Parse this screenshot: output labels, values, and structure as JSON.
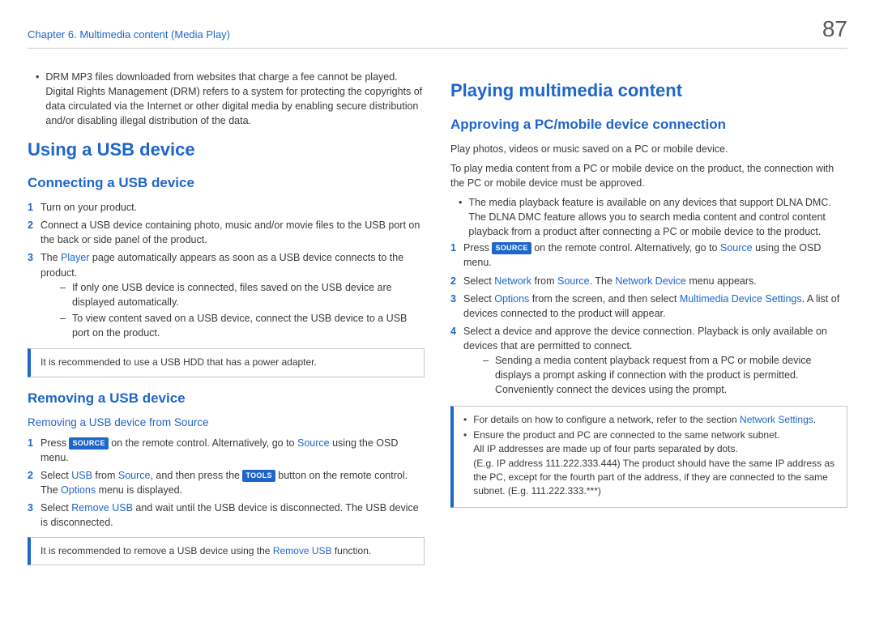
{
  "page_number": "87",
  "header": "Chapter 6. Multimedia content (Media Play)",
  "left": {
    "intro_bullet_pre": "DRM MP3 files downloaded from websites that charge a fee cannot be played.",
    "intro_bullet_post": "Digital Rights Management (DRM) refers to a system for protecting the copyrights of data circulated via the Internet or other digital media by enabling secure distribution and/or disabling illegal distribution of the data.",
    "h1_usb": "Using a USB device",
    "h2_connect": "Connecting a USB device",
    "c1": "Turn on your product.",
    "c2": "Connect a USB device containing photo, music and/or movie files to the USB port on the back or side panel of the product.",
    "c3_pre": "The ",
    "c3_player": "Player",
    "c3_post": " page automatically appears as soon as a USB device connects to the product.",
    "c3_d1": "If only one USB device is connected, files saved on the USB device are displayed automatically.",
    "c3_d2": "To view content saved on a USB device, connect the USB device to a USB port on the product.",
    "note1": "It is recommended to use a USB HDD that has a power adapter.",
    "h2_remove": "Removing a USB device",
    "h3_remove": "Removing a USB device from Source",
    "r1_pre": "Press ",
    "r1_key": "SOURCE",
    "r1_mid": " on the remote control. Alternatively, go to ",
    "r1_source": "Source",
    "r1_post": " using the OSD menu.",
    "r2_pre": "Select ",
    "r2_usb": "USB",
    "r2_mid1": " from ",
    "r2_src": "Source",
    "r2_mid2": ", and then press the ",
    "r2_key": "TOOLS",
    "r2_mid3": " button on the remote control. The ",
    "r2_opt": "Options",
    "r2_post": " menu is displayed.",
    "r3_pre": "Select ",
    "r3_rem": "Remove USB",
    "r3_post": " and wait until the USB device is disconnected. The USB device is disconnected.",
    "note2_pre": "It is recommended to remove a USB device using the ",
    "note2_rem": "Remove USB",
    "note2_post": " function."
  },
  "right": {
    "h1_play": "Playing multimedia content",
    "h2_approve": "Approving a PC/mobile device connection",
    "p1": "Play photos, videos or music saved on a PC or mobile device.",
    "p2": "To play media content from a PC or mobile device on the product, the connection with the PC or mobile device must be approved.",
    "b1": "The media playback feature is available on any devices that support DLNA DMC. The DLNA DMC feature allows you to search media content and control content playback from a product after connecting a PC or mobile device to the product.",
    "s1_pre": "Press ",
    "s1_key": "SOURCE",
    "s1_mid": " on the remote control. Alternatively, go to ",
    "s1_source": "Source",
    "s1_post": " using the OSD menu.",
    "s2_pre": "Select ",
    "s2_net": "Network",
    "s2_mid1": " from ",
    "s2_src": "Source",
    "s2_mid2": ". The ",
    "s2_netdev": "Network Device",
    "s2_post": " menu appears.",
    "s3_pre": "Select ",
    "s3_opt": "Options",
    "s3_mid": " from the screen, and then select ",
    "s3_mds": "Multimedia Device Settings",
    "s3_post": ". A list of devices connected to the product will appear.",
    "s4": "Select a device and approve the device connection. Playback is only available on devices that are permitted to connect.",
    "s4_d1": "Sending a media content playback request from a PC or mobile device displays a prompt asking if connection with the product is permitted. Conveniently connect the devices using the prompt.",
    "note3_b1_pre": "For details on how to configure a network, refer to the section ",
    "note3_b1_link": "Network Settings",
    "note3_b1_post": ".",
    "note3_b2a": "Ensure the product and PC are connected to the same network subnet.",
    "note3_b2b": "All IP addresses are made up of four parts separated by dots.",
    "note3_b2c": "(E.g. IP address 111.222.333.444) The product should have the same IP address as the PC, except for the fourth part of the address, if they are connected to the same subnet. (E.g. 111.222.333.***)"
  }
}
